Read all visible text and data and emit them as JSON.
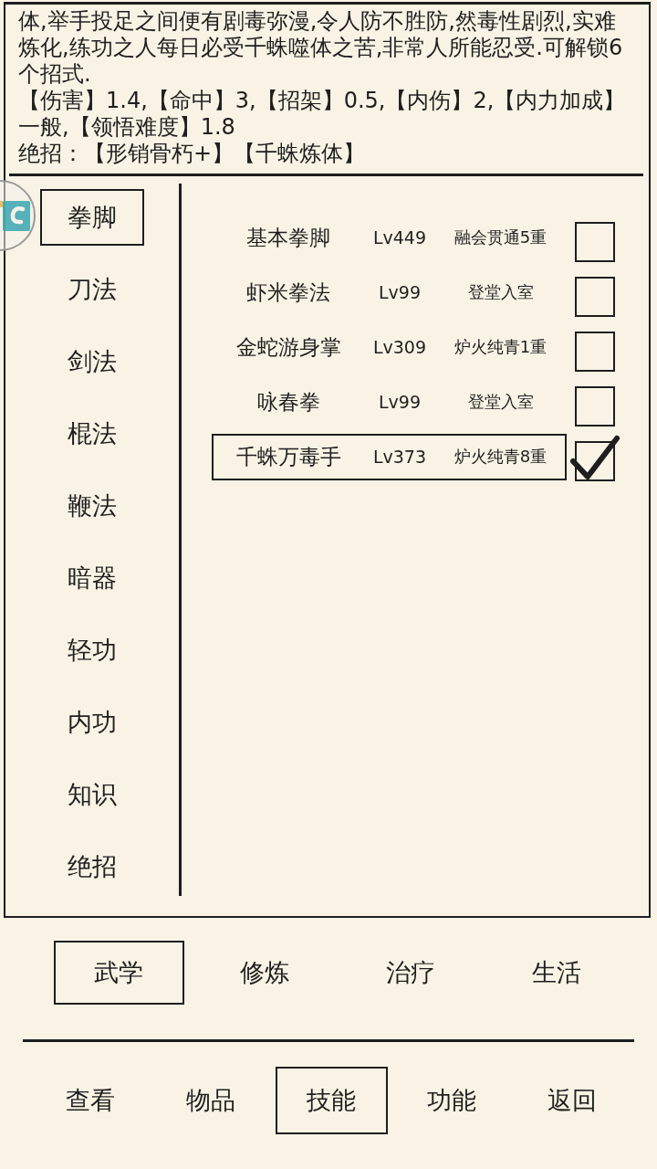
{
  "description": {
    "text": "体,举手投足之间便有剧毒弥漫,令人防不胜防,然毒性剧烈,实难炼化,练功之人每日必受千蛛噬体之苦,非常人所能忍受.可解锁6个招式.",
    "stats": "【伤害】1.4,【命中】3,【招架】0.5,【内伤】2,【内力加成】一般,【领悟难度】1.8",
    "ultimate_moves": "绝招：【形销骨朽+】【千蛛炼体】"
  },
  "categories": [
    {
      "label": "拳脚",
      "selected": true
    },
    {
      "label": "刀法",
      "selected": false
    },
    {
      "label": "剑法",
      "selected": false
    },
    {
      "label": "棍法",
      "selected": false
    },
    {
      "label": "鞭法",
      "selected": false
    },
    {
      "label": "暗器",
      "selected": false
    },
    {
      "label": "轻功",
      "selected": false
    },
    {
      "label": "内功",
      "selected": false
    },
    {
      "label": "知识",
      "selected": false
    },
    {
      "label": "绝招",
      "selected": false
    }
  ],
  "skills": [
    {
      "name": "基本拳脚",
      "level": "Lv449",
      "realm": "融会贯通5重",
      "selected": false,
      "checked": false
    },
    {
      "name": "虾米拳法",
      "level": "Lv99",
      "realm": "登堂入室",
      "selected": false,
      "checked": false
    },
    {
      "name": "金蛇游身掌",
      "level": "Lv309",
      "realm": "炉火纯青1重",
      "selected": false,
      "checked": false
    },
    {
      "name": "咏春拳",
      "level": "Lv99",
      "realm": "登堂入室",
      "selected": false,
      "checked": false
    },
    {
      "name": "千蛛万毒手",
      "level": "Lv373",
      "realm": "炉火纯青8重",
      "selected": true,
      "checked": true
    }
  ],
  "tabs": [
    {
      "label": "武学",
      "selected": true
    },
    {
      "label": "修炼",
      "selected": false
    },
    {
      "label": "治疗",
      "selected": false
    },
    {
      "label": "生活",
      "selected": false
    }
  ],
  "nav": [
    {
      "label": "查看",
      "selected": false
    },
    {
      "label": "物品",
      "selected": false
    },
    {
      "label": "技能",
      "selected": true
    },
    {
      "label": "功能",
      "selected": false
    },
    {
      "label": "返回",
      "selected": false
    }
  ]
}
